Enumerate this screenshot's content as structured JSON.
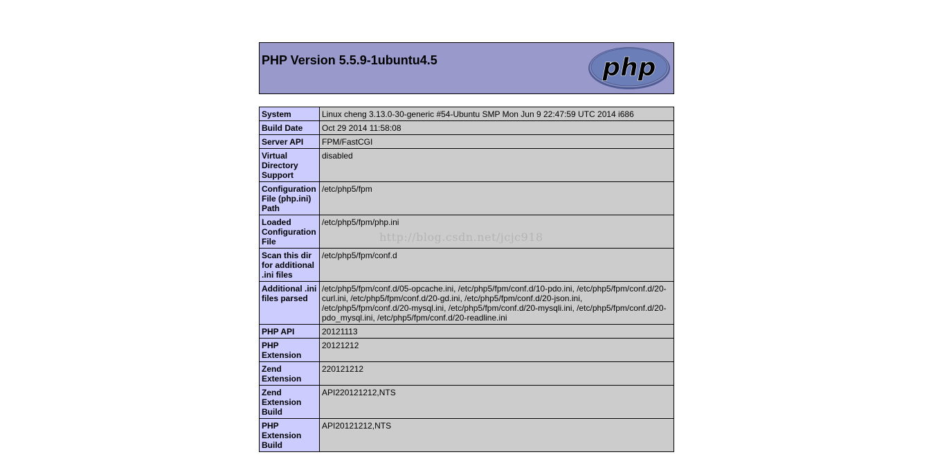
{
  "header": {
    "title": "PHP Version 5.5.9-1ubuntu4.5",
    "logo_text": "php"
  },
  "info_rows": [
    {
      "key": "System",
      "value": "Linux cheng 3.13.0-30-generic #54-Ubuntu SMP Mon Jun 9 22:47:59 UTC 2014 i686"
    },
    {
      "key": "Build Date",
      "value": "Oct 29 2014 11:58:08"
    },
    {
      "key": "Server API",
      "value": "FPM/FastCGI"
    },
    {
      "key": "Virtual Directory Support",
      "value": "disabled"
    },
    {
      "key": "Configuration File (php.ini) Path",
      "value": "/etc/php5/fpm"
    },
    {
      "key": "Loaded Configuration File",
      "value": "/etc/php5/fpm/php.ini"
    },
    {
      "key": "Scan this dir for additional .ini files",
      "value": "/etc/php5/fpm/conf.d"
    },
    {
      "key": "Additional .ini files parsed",
      "value": "/etc/php5/fpm/conf.d/05-opcache.ini, /etc/php5/fpm/conf.d/10-pdo.ini, /etc/php5/fpm/conf.d/20-curl.ini, /etc/php5/fpm/conf.d/20-gd.ini, /etc/php5/fpm/conf.d/20-json.ini, /etc/php5/fpm/conf.d/20-mysql.ini, /etc/php5/fpm/conf.d/20-mysqli.ini, /etc/php5/fpm/conf.d/20-pdo_mysql.ini, /etc/php5/fpm/conf.d/20-readline.ini"
    },
    {
      "key": "PHP API",
      "value": "20121113"
    },
    {
      "key": "PHP Extension",
      "value": "20121212"
    },
    {
      "key": "Zend Extension",
      "value": "220121212"
    },
    {
      "key": "Zend Extension Build",
      "value": "API220121212,NTS"
    },
    {
      "key": "PHP Extension Build",
      "value": "API20121212,NTS"
    }
  ],
  "watermark": "http://blog.csdn.net/jcjc918",
  "colors": {
    "header_bg": "#9999cc",
    "key_bg": "#ccccff",
    "value_bg": "#cccccc",
    "logo_fill": "#6c7eb7"
  }
}
